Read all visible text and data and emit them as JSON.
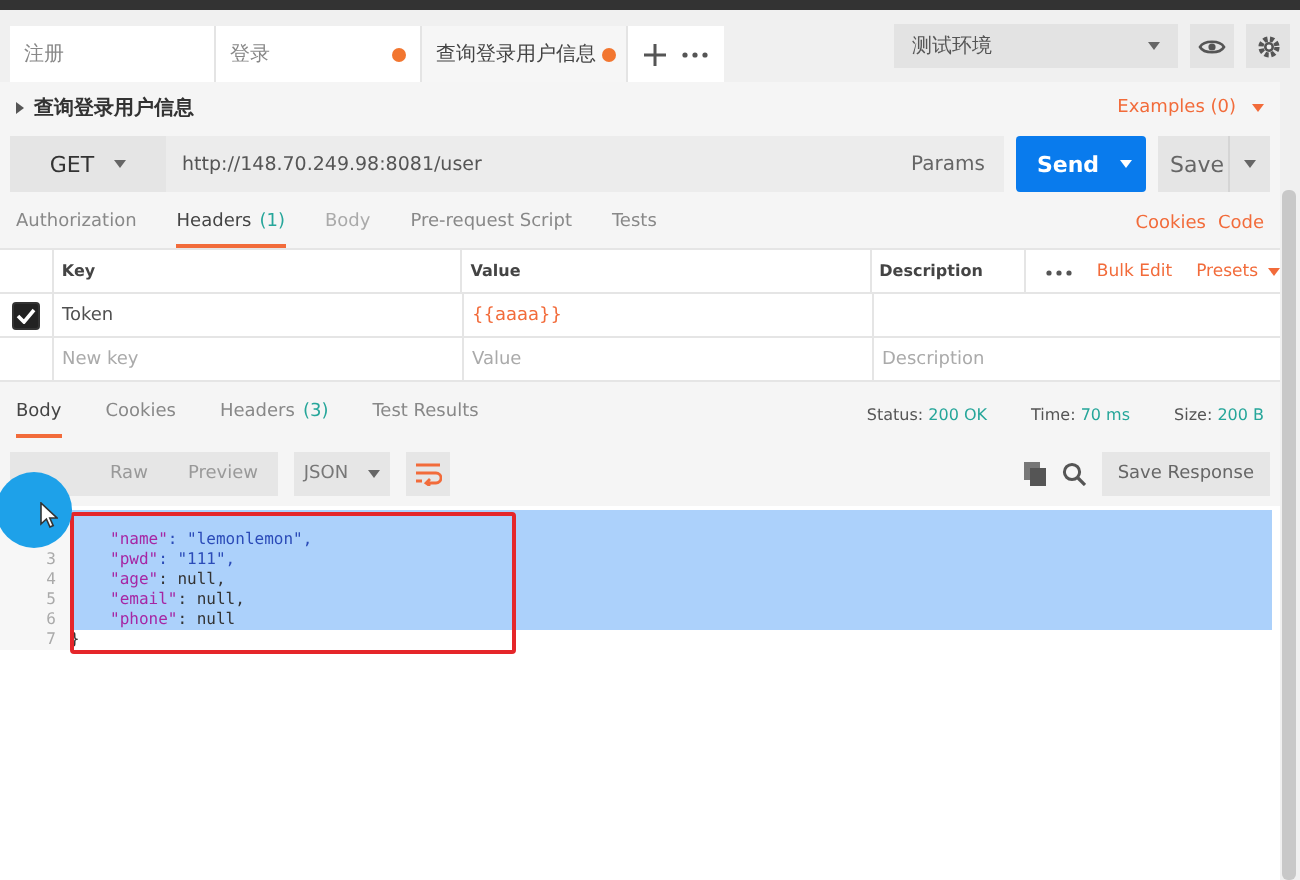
{
  "tabs": [
    {
      "label": "注册",
      "modified": false,
      "selected": false
    },
    {
      "label": "登录",
      "modified": true,
      "selected": false
    },
    {
      "label": "查询登录用户信息",
      "modified": true,
      "selected": true
    }
  ],
  "environment": "测试环境",
  "request_name": "查询登录用户信息",
  "examples": "Examples (0)",
  "method": "GET",
  "url": "http://148.70.249.98:8081/user",
  "params": "Params",
  "send": "Send",
  "save": "Save",
  "request_tabs": [
    {
      "label": "Authorization",
      "disabled": false,
      "selected": false
    },
    {
      "label": "Headers",
      "count": "(1)",
      "disabled": false,
      "selected": true
    },
    {
      "label": "Body",
      "disabled": true,
      "selected": false
    },
    {
      "label": "Pre-request Script",
      "disabled": false,
      "selected": false
    },
    {
      "label": "Tests",
      "disabled": false,
      "selected": false
    }
  ],
  "links": [
    "Cookies",
    "Code"
  ],
  "headers_table": {
    "columns": [
      "Key",
      "Value",
      "Description"
    ],
    "bulk_edit": "Bulk Edit",
    "presets": "Presets",
    "rows": [
      {
        "checked": true,
        "key": "Token",
        "value": "{{aaaa}}"
      }
    ],
    "placeholders": {
      "key": "New key",
      "value": "Value",
      "description": "Description"
    }
  },
  "response_tabs": [
    {
      "label": "Body",
      "selected": true
    },
    {
      "label": "Cookies",
      "selected": false
    },
    {
      "label": "Headers",
      "count": "(3)",
      "selected": false
    },
    {
      "label": "Test Results",
      "selected": false
    }
  ],
  "status": [
    {
      "label": "Status:",
      "value": "200 OK"
    },
    {
      "label": "Time:",
      "value": "70 ms"
    },
    {
      "label": "Size:",
      "value": "200 B"
    }
  ],
  "view_modes": [
    {
      "label": "Raw",
      "selected": false
    },
    {
      "label": "Preview",
      "selected": false
    }
  ],
  "format": "JSON",
  "save_response": "Save Response",
  "code_lines": [
    {
      "text": "\"name\": \"lemonlemon\",",
      "kind": "string",
      "selected": true
    },
    {
      "number": "3",
      "text": "\"pwd\": \"111\",",
      "kind": "string",
      "selected": true
    },
    {
      "number": "4",
      "text": "\"age\": null,",
      "kind": "null",
      "selected": true
    },
    {
      "number": "5",
      "text": "\"email\": null,",
      "kind": "null",
      "selected": true
    },
    {
      "number": "6",
      "text": "\"phone\": null",
      "kind": "null",
      "selected": true
    },
    {
      "number": "7",
      "text": "}",
      "kind": "brace",
      "selected": false
    }
  ]
}
